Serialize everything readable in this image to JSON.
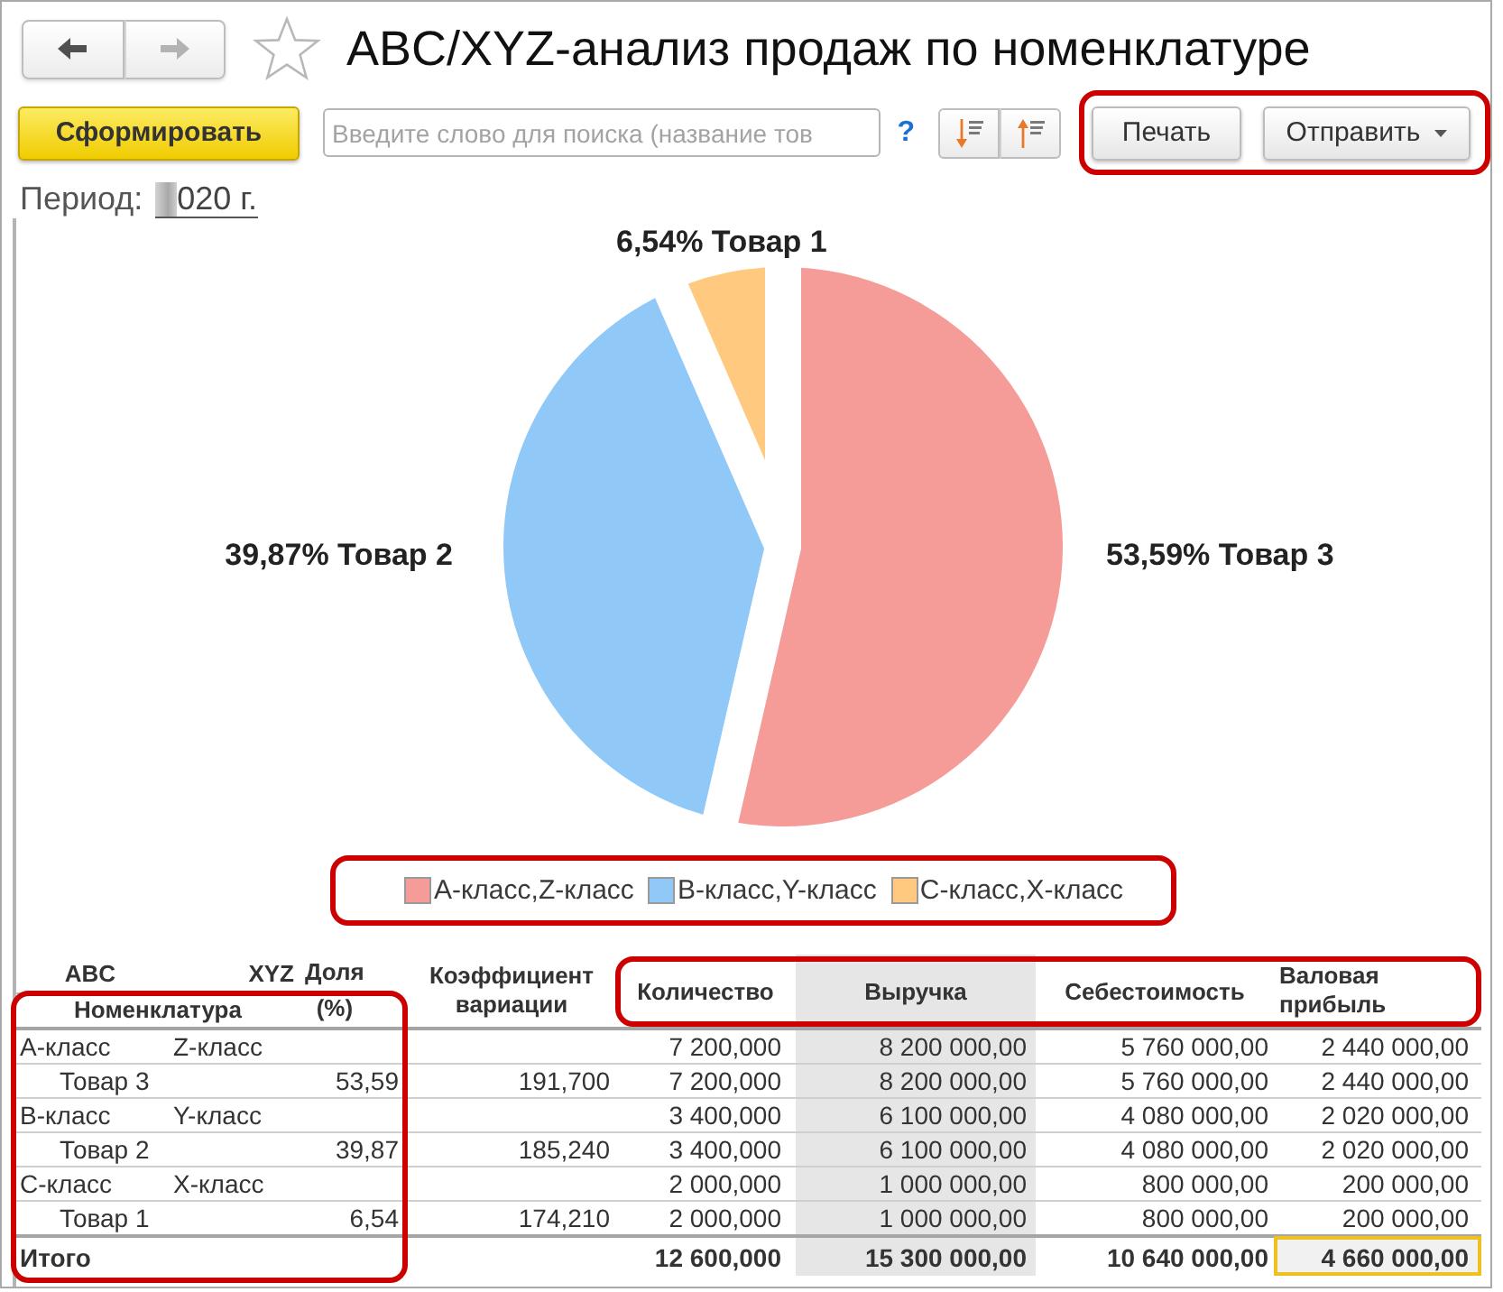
{
  "header": {
    "nav_buttons": [
      {
        "kind": "back",
        "disabled": false
      },
      {
        "kind": "forward",
        "disabled": true
      }
    ],
    "favorite": false,
    "title": "ABC/XYZ-анализ продаж по номенклатуре"
  },
  "toolbar": {
    "generate_button": "Сформировать",
    "search": {
      "placeholder": "Введите слово для поиска (название тов"
    },
    "help": "?",
    "sort_buttons": [
      {
        "kind": "down"
      },
      {
        "kind": "up"
      }
    ],
    "actions_highlighted": true,
    "actions": [
      {
        "kind": "button",
        "label": "Печать"
      },
      {
        "kind": "dropdown",
        "label": "Отправить"
      }
    ]
  },
  "period": {
    "label": "Период:",
    "redacted": true,
    "value": "020 г."
  },
  "chart": {
    "chart_data": {
      "type": "pie",
      "categories": [
        "А-класс,Z-класс",
        "В-класс,Y-класс",
        "С-класс,X-класс"
      ],
      "values": [
        53.59,
        39.87,
        6.54
      ],
      "value_labels": [
        "53,59% Товар 3",
        "39,87% Товар 2",
        "6,54% Товар 1"
      ]
    }
  },
  "legend": {
    "highlighted": true,
    "items": [
      {
        "color": "#f59b98"
      },
      {
        "color": "#90c8f8"
      },
      {
        "color": "#ffc97f"
      }
    ]
  },
  "table": {
    "left_highlighted": true,
    "header_highlighted": true,
    "header": {
      "abc": "ABC",
      "xyz": "XYZ",
      "nomenclature": "Номенклатура",
      "share": "Доля (%)",
      "variation": "Коэффициент вариации",
      "quantity": "Количество",
      "revenue": "Выручка",
      "cost": "Себестоимость",
      "profit": "Валовая прибыль"
    },
    "rows": [
      {
        "kind": "group",
        "abc": "А-класс",
        "xyz": "Z-класс",
        "quantity": "7 200,000",
        "revenue": "8 200 000,00",
        "cost": "5 760 000,00",
        "profit": "2 440 000,00"
      },
      {
        "kind": "item",
        "name": "Товар 3",
        "share": "53,59",
        "variation": "191,700",
        "quantity": "7 200,000",
        "revenue": "8 200 000,00",
        "cost": "5 760 000,00",
        "profit": "2 440 000,00"
      },
      {
        "kind": "group",
        "abc": "В-класс",
        "xyz": "Y-класс",
        "quantity": "3 400,000",
        "revenue": "6 100 000,00",
        "cost": "4 080 000,00",
        "profit": "2 020 000,00"
      },
      {
        "kind": "item",
        "name": "Товар 2",
        "share": "39,87",
        "variation": "185,240",
        "quantity": "3 400,000",
        "revenue": "6 100 000,00",
        "cost": "4 080 000,00",
        "profit": "2 020 000,00"
      },
      {
        "kind": "group",
        "abc": "С-класс",
        "xyz": "X-класс",
        "quantity": "2 000,000",
        "revenue": "1 000 000,00",
        "cost": "800 000,00",
        "profit": "200 000,00"
      },
      {
        "kind": "item",
        "name": "Товар 1",
        "share": "6,54",
        "variation": "174,210",
        "quantity": "2 000,000",
        "revenue": "1 000 000,00",
        "cost": "800 000,00",
        "profit": "200 000,00"
      }
    ],
    "total": {
      "label": "Итого",
      "cells": [
        {
          "text": "12 600,000",
          "selected": false
        },
        {
          "text": "15 300 000,00",
          "selected": false
        },
        {
          "text": "10 640 000,00",
          "selected": false
        },
        {
          "text": "4 660 000,00",
          "selected": true
        }
      ]
    }
  }
}
